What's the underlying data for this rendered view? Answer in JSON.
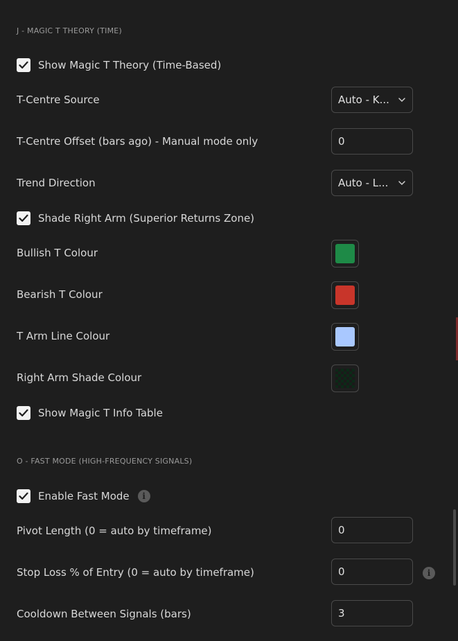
{
  "colors": {
    "background": "#1e1e1e",
    "bullish": "#1e8a47",
    "bearish": "#c8352a",
    "arm_line": "#a9c8ff"
  },
  "section_j": {
    "title": "J - MAGIC T THEORY (TIME)",
    "show_magic_t": {
      "label": "Show Magic T Theory (Time-Based)",
      "checked": true
    },
    "t_centre_source": {
      "label": "T-Centre Source",
      "value": "Auto - K..."
    },
    "t_centre_offset": {
      "label": "T-Centre Offset (bars ago) - Manual mode only",
      "value": "0"
    },
    "trend_direction": {
      "label": "Trend Direction",
      "value": "Auto - L..."
    },
    "shade_right_arm": {
      "label": "Shade Right Arm (Superior Returns Zone)",
      "checked": true
    },
    "bullish_colour": {
      "label": "Bullish T Colour"
    },
    "bearish_colour": {
      "label": "Bearish T Colour"
    },
    "arm_line_colour": {
      "label": "T Arm Line Colour"
    },
    "right_arm_shade_colour": {
      "label": "Right Arm Shade Colour"
    },
    "show_info_table": {
      "label": "Show Magic T Info Table",
      "checked": true
    }
  },
  "section_o": {
    "title": "O - FAST MODE (HIGH-FREQUENCY SIGNALS)",
    "enable_fast_mode": {
      "label": "Enable Fast Mode",
      "checked": true,
      "info_icon": "info-icon"
    },
    "pivot_length": {
      "label": "Pivot Length (0 = auto by timeframe)",
      "value": "0"
    },
    "stop_loss": {
      "label": "Stop Loss % of Entry (0 = auto by timeframe)",
      "value": "0",
      "info_icon": "info-icon"
    },
    "cooldown": {
      "label": "Cooldown Between Signals (bars)",
      "value": "3"
    }
  }
}
